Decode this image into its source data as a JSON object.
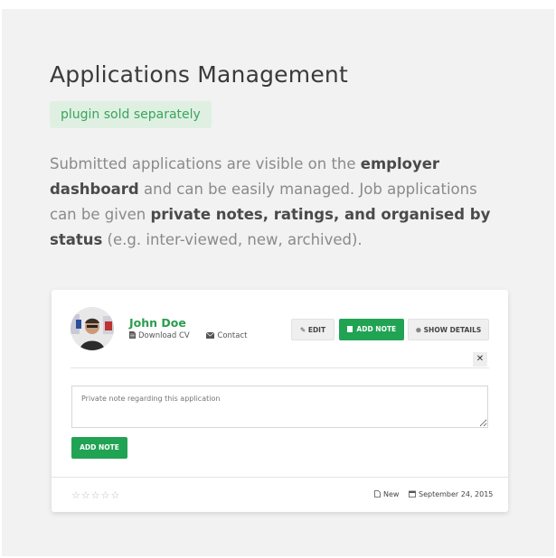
{
  "header": {
    "title": "Applications Management",
    "badge": "plugin sold separately"
  },
  "description": {
    "p1": "Submitted applications are visible on the ",
    "b1": "employer dashboard",
    "p2": " and can be easily managed. Job applications can be given ",
    "b2": "private notes, ratings, and organised by status",
    "p3": " (e.g. inter-viewed, new, archived)."
  },
  "card": {
    "applicant_name": "John Doe",
    "download_cv": "Download CV",
    "contact": "Contact",
    "buttons": {
      "edit": "EDIT",
      "add_note": "ADD NOTE",
      "show_details": "SHOW DETAILS"
    },
    "close_glyph": "✕",
    "note_placeholder": "Private note regarding this application",
    "submit_note": "ADD NOTE",
    "rating_stars": "☆☆☆☆☆",
    "status": "New",
    "date": "September 24, 2015",
    "colors": {
      "accent_green": "#21a354",
      "name_green": "#2a9d4e",
      "badge_bg": "#dff0e3"
    }
  }
}
